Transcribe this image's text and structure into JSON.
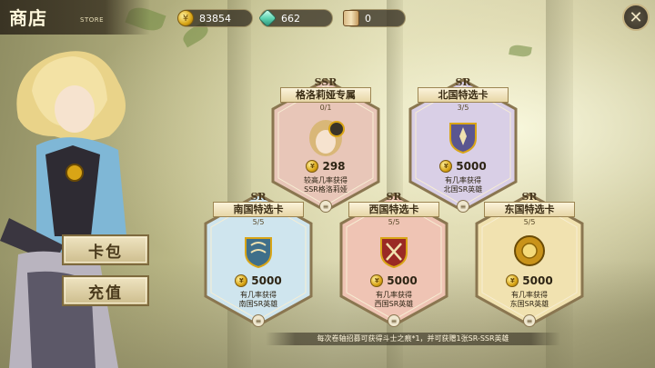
{
  "header": {
    "title": "商店",
    "subtitle": "STORE"
  },
  "currencies": [
    {
      "icon": "gold-coin-icon",
      "value": "83854"
    },
    {
      "icon": "green-gem-icon",
      "value": "662"
    },
    {
      "icon": "scroll-icon",
      "value": "0"
    }
  ],
  "side_buttons": {
    "card_pack": "卡包",
    "recharge": "充值"
  },
  "cards": [
    {
      "rarity": "SSR",
      "name": "格洛莉娅专属",
      "count": "0/1",
      "price": "298",
      "desc_line1": "较高几率获得",
      "desc_line2": "SSR格洛莉娅",
      "emblem": "character-portrait",
      "theme": "#e8c6b8"
    },
    {
      "rarity": "SR",
      "name": "北国特选卡",
      "count": "3/5",
      "price": "5000",
      "desc_line1": "有几率获得",
      "desc_line2": "北国SR英雄",
      "emblem": "north-crest-icon",
      "theme": "#d9cfe6"
    },
    {
      "rarity": "SR",
      "name": "南国特选卡",
      "count": "5/5",
      "price": "5000",
      "desc_line1": "有几率获得",
      "desc_line2": "南国SR英雄",
      "emblem": "south-crest-icon",
      "theme": "#cfe5ee"
    },
    {
      "rarity": "SR",
      "name": "西国特选卡",
      "count": "5/5",
      "price": "5000",
      "desc_line1": "有几率获得",
      "desc_line2": "西国SR英雄",
      "emblem": "west-crest-icon",
      "theme": "#efc4b4"
    },
    {
      "rarity": "SR",
      "name": "东国特选卡",
      "count": "5/5",
      "price": "5000",
      "desc_line1": "有几率获得",
      "desc_line2": "东国SR英雄",
      "emblem": "east-crest-icon",
      "theme": "#f1e2b0"
    }
  ],
  "footer_note": "每次卷轴招募可获得斗士之痕*1，并可获赠1张SR-SSR英雄",
  "colors": {
    "gold": "#d9a516",
    "frame": "#8a7650",
    "panel": "#fbf3da"
  }
}
